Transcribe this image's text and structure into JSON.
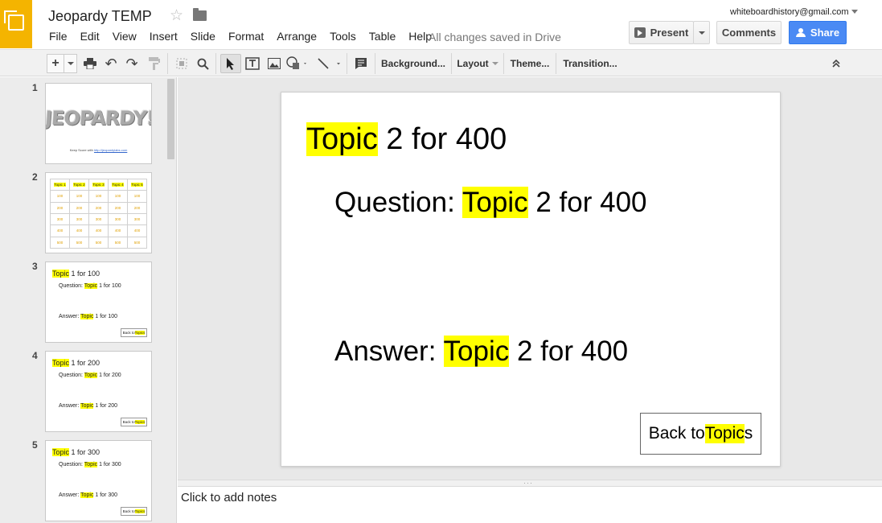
{
  "header": {
    "doc_title": "Jeopardy TEMP",
    "menu": [
      "File",
      "Edit",
      "View",
      "Insert",
      "Slide",
      "Format",
      "Arrange",
      "Tools",
      "Table",
      "Help"
    ],
    "save_status": "All changes saved in Drive",
    "account_email": "whiteboardhistory@gmail.com",
    "present_label": "Present",
    "comments_label": "Comments",
    "share_label": "Share",
    "accent_color": "#f4b400",
    "share_color": "#4a8af4"
  },
  "toolbar": {
    "new_slide_label": "+",
    "background_label": "Background...",
    "layout_label": "Layout",
    "theme_label": "Theme...",
    "transition_label": "Transition...",
    "icons": [
      "print-icon",
      "undo-icon",
      "redo-icon",
      "paint-format-icon",
      "select-frame-icon",
      "zoom-icon",
      "select-cursor-icon",
      "textbox-icon",
      "image-icon",
      "shape-icon",
      "line-icon",
      "comment-icon",
      "collapse-icon"
    ]
  },
  "filmstrip": {
    "slides": [
      {
        "number": "1",
        "logo_text": "JEOPARDY!",
        "keep_score": "Keep Score with",
        "link": "http://jeopardylabs.com"
      },
      {
        "number": "2",
        "topics": [
          "Topic 1",
          "Topic 2",
          "Topic 3",
          "Topic 4",
          "Topic 5"
        ],
        "values": [
          "100",
          "200",
          "300",
          "400",
          "500"
        ]
      },
      {
        "number": "3",
        "title_hl": "Topic",
        "title_rest": " 1 for 100",
        "q_pre": "Question: ",
        "q_hl": "Topic",
        "q_rest": " 1 for 100",
        "a_pre": "Answer: ",
        "a_hl": "Topic",
        "a_rest": " 1 for 100",
        "back_pre": "Back to ",
        "back_hl": "Topics"
      },
      {
        "number": "4",
        "title_hl": "Topic",
        "title_rest": " 1 for 200",
        "q_pre": "Question: ",
        "q_hl": "Topic",
        "q_rest": " 1 for 200",
        "a_pre": "Answer: ",
        "a_hl": "Topic",
        "a_rest": " 1 for 200",
        "back_pre": "Back to ",
        "back_hl": "Topics"
      },
      {
        "number": "5",
        "title_hl": "Topic",
        "title_rest": " 1 for 300",
        "q_pre": "Question: ",
        "q_hl": "Topic",
        "q_rest": " 1 for 300",
        "a_pre": "Answer: ",
        "a_hl": "Topic",
        "a_rest": " 1 for 300",
        "back_pre": "Back to ",
        "back_hl": "Topics"
      }
    ]
  },
  "slide": {
    "title_hl": "Topic",
    "title_rest": " 2 for 400",
    "question_pre": "Question: ",
    "question_hl": "Topic",
    "question_rest": " 2 for 400",
    "answer_pre": "Answer: ",
    "answer_hl": "Topic",
    "answer_rest": " 2 for 400",
    "back_pre": "Back to ",
    "back_hl": "Topic",
    "back_rest": "s",
    "highlight_color": "#ffff00"
  },
  "notes": {
    "placeholder": "Click to add notes"
  }
}
